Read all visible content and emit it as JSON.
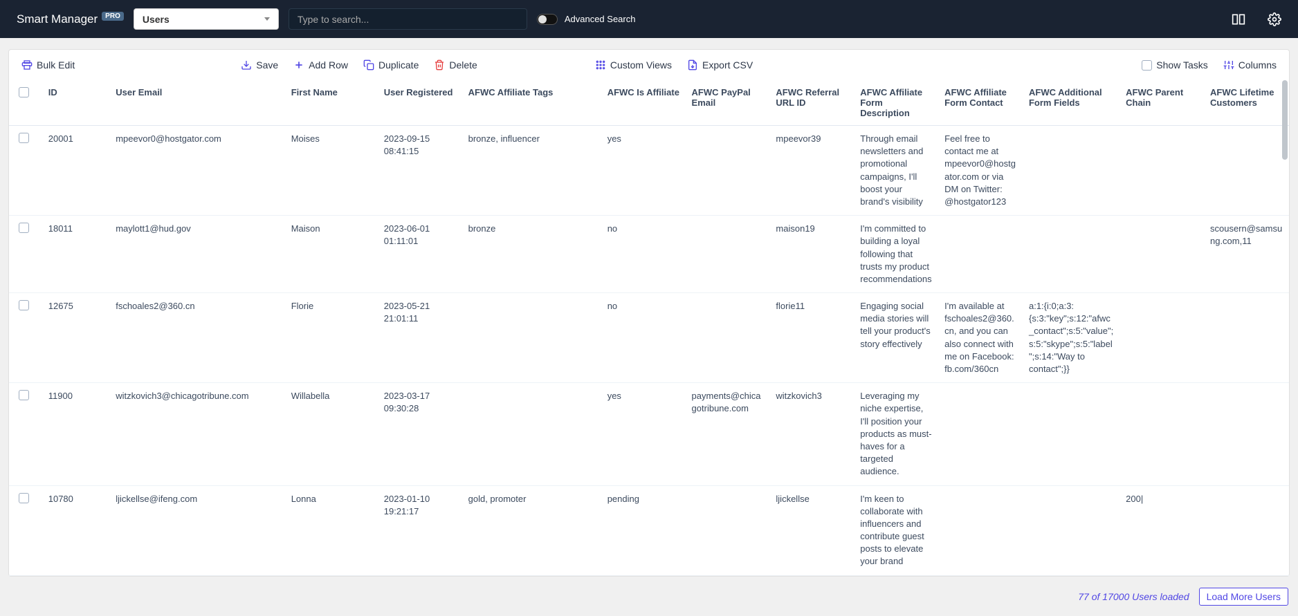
{
  "header": {
    "brand": "Smart Manager",
    "pro_badge": "PRO",
    "dashboard_selected": "Users",
    "search_placeholder": "Type to search...",
    "advanced_search_label": "Advanced Search"
  },
  "toolbar": {
    "bulk_edit": "Bulk Edit",
    "save": "Save",
    "add_row": "Add Row",
    "duplicate": "Duplicate",
    "delete": "Delete",
    "custom_views": "Custom Views",
    "export_csv": "Export CSV",
    "show_tasks": "Show Tasks",
    "columns": "Columns"
  },
  "columns": [
    "ID",
    "User Email",
    "First Name",
    "User Registered",
    "AFWC Affiliate Tags",
    "AFWC Is Affiliate",
    "AFWC PayPal Email",
    "AFWC Referral URL ID",
    "AFWC Affiliate Form Description",
    "AFWC Affiliate Form Contact",
    "AFWC Additional Form Fields",
    "AFWC Parent Chain",
    "AFWC Lifetime Customers"
  ],
  "rows": [
    {
      "id": "20001",
      "email": "mpeevor0@hostgator.com",
      "first_name": "Moises",
      "registered": "2023-09-15 08:41:15",
      "tags": "bronze, influencer",
      "is_affiliate": "yes",
      "paypal": "",
      "referral_id": "mpeevor39",
      "form_desc": "Through email newsletters and promotional campaigns, I'll boost your brand's visibility",
      "form_contact": "Feel free to contact me at mpeevor0@hostgator.com or via DM on Twitter: @hostgator123",
      "additional": "",
      "parent": "",
      "lifetime": ""
    },
    {
      "id": "18011",
      "email": "maylott1@hud.gov",
      "first_name": "Maison",
      "registered": "2023-06-01 01:11:01",
      "tags": "bronze",
      "is_affiliate": "no",
      "paypal": "",
      "referral_id": "maison19",
      "form_desc": "I'm committed to building a loyal following that trusts my product recommendations",
      "form_contact": "",
      "additional": "",
      "parent": "",
      "lifetime": "scousern@samsung.com,11"
    },
    {
      "id": "12675",
      "email": "fschoales2@360.cn",
      "first_name": "Florie",
      "registered": "2023-05-21 21:01:11",
      "tags": "",
      "is_affiliate": "no",
      "paypal": "",
      "referral_id": "florie11",
      "form_desc": "Engaging social media stories will tell your product's story effectively",
      "form_contact": "I'm available at fschoales2@360.cn, and you can also connect with me on Facebook: fb.com/360cn",
      "additional": "a:1:{i:0;a:3:{s:3:\"key\";s:12:\"afwc_contact\";s:5:\"value\";s:5:\"skype\";s:5:\"label\";s:14:\"Way to contact\";}}",
      "parent": "",
      "lifetime": ""
    },
    {
      "id": "11900",
      "email": "witzkovich3@chicagotribune.com",
      "first_name": "Willabella",
      "registered": "2023-03-17 09:30:28",
      "tags": "",
      "is_affiliate": "yes",
      "paypal": "payments@chicagotribune.com",
      "referral_id": "witzkovich3",
      "form_desc": "Leveraging my niche expertise, I'll position your products as must-haves for a targeted audience.",
      "form_contact": "",
      "additional": "",
      "parent": "",
      "lifetime": ""
    },
    {
      "id": "10780",
      "email": "ljickellse@ifeng.com",
      "first_name": "Lonna",
      "registered": "2023-01-10 19:21:17",
      "tags": "gold, promoter",
      "is_affiliate": "pending",
      "paypal": "",
      "referral_id": "ljickellse",
      "form_desc": "I'm keen to collaborate with influencers and contribute guest posts to elevate your brand",
      "form_contact": "",
      "additional": "",
      "parent": "200|",
      "lifetime": ""
    }
  ],
  "footer": {
    "loaded_status": "77 of 17000 Users loaded",
    "load_more_label": "Load More Users"
  }
}
